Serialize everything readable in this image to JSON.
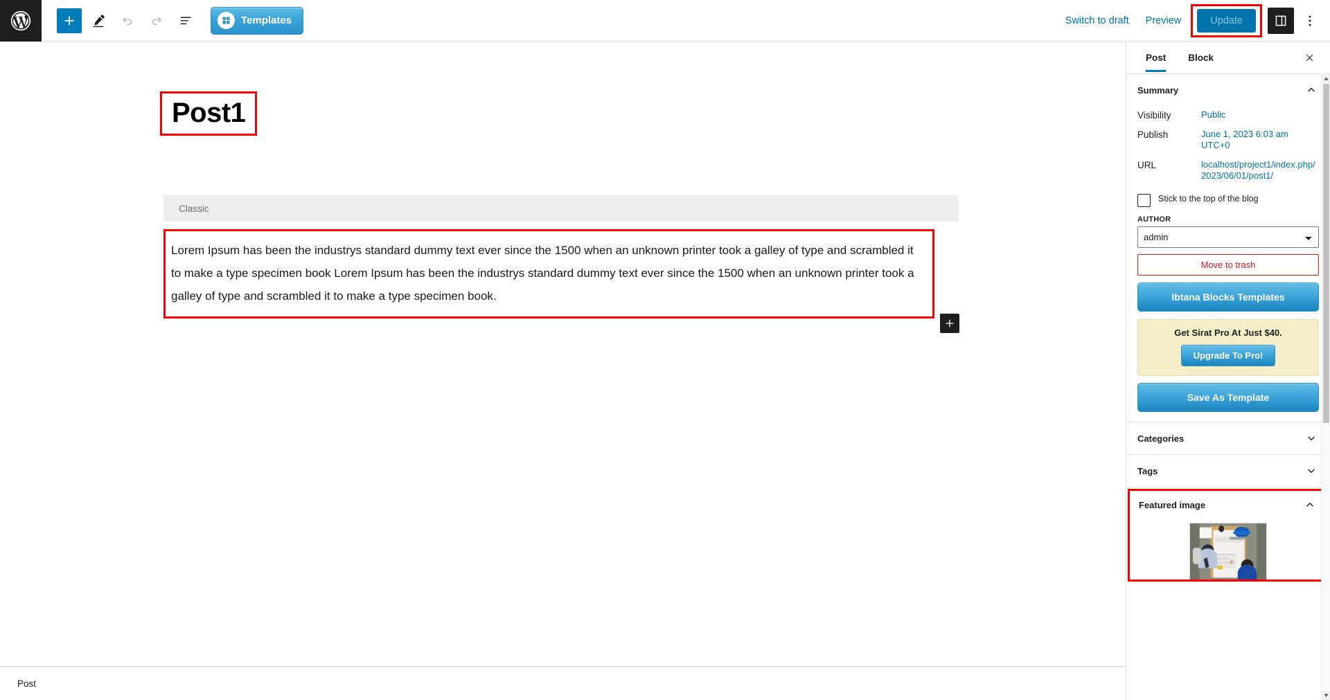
{
  "toolbar": {
    "logo_icon": "wordpress-logo",
    "add_block_label": "+",
    "edit_tool_label": "Edit",
    "undo_label": "Undo",
    "redo_label": "Redo",
    "list_view_label": "Document Overview",
    "templates_label": "Templates",
    "switch_to_draft_label": "Switch to draft",
    "preview_label": "Preview",
    "update_label": "Update",
    "settings_toggle_label": "Settings",
    "options_label": "Options"
  },
  "editor": {
    "post_title": "Post1",
    "classic_block_label": "Classic",
    "paragraph_text": "Lorem Ipsum has been the industrys standard dummy text ever since the 1500 when an unknown printer took a galley of type and scrambled it to make a type specimen book Lorem Ipsum has been the industrys standard dummy text ever since the 1500 when an unknown printer took a galley of type and scrambled it to make a type specimen book.",
    "add_block_label": "+"
  },
  "statusbar": {
    "document_type": "Post"
  },
  "sidebar": {
    "tabs": [
      {
        "label": "Post",
        "active": true
      },
      {
        "label": "Block",
        "active": false
      }
    ],
    "close_label": "Close Settings",
    "summary": {
      "title": "Summary",
      "rows": [
        {
          "label": "Visibility",
          "value": "Public"
        },
        {
          "label": "Publish",
          "value": "June 1, 2023 6:03 am UTC+0"
        },
        {
          "label": "URL",
          "value": "localhost/project1/index.php/2023/06/01/post1/"
        }
      ],
      "sticky_label": "Stick to the top of the blog",
      "author_label": "AUTHOR",
      "author_value": "admin",
      "author_options": [
        "admin"
      ],
      "trash_label": "Move to trash",
      "ibtana_templates_label": "Ibtana Blocks Templates",
      "promo_text": "Get Sirat Pro At Just $40.",
      "promo_button_label": "Upgrade To Pro!",
      "save_template_label": "Save As Template"
    },
    "categories": {
      "title": "Categories"
    },
    "tags": {
      "title": "Tags"
    },
    "featured_image": {
      "title": "Featured image",
      "image_alt": "People reviewing blueprints at a table with a blue hard hat"
    }
  },
  "colors": {
    "accent_blue": "#007cba",
    "link_blue": "#0073aa",
    "highlight_red": "#f70000",
    "danger_red": "#cc1818",
    "dark": "#1e1e1e",
    "promo_bg": "#f6edc9"
  }
}
